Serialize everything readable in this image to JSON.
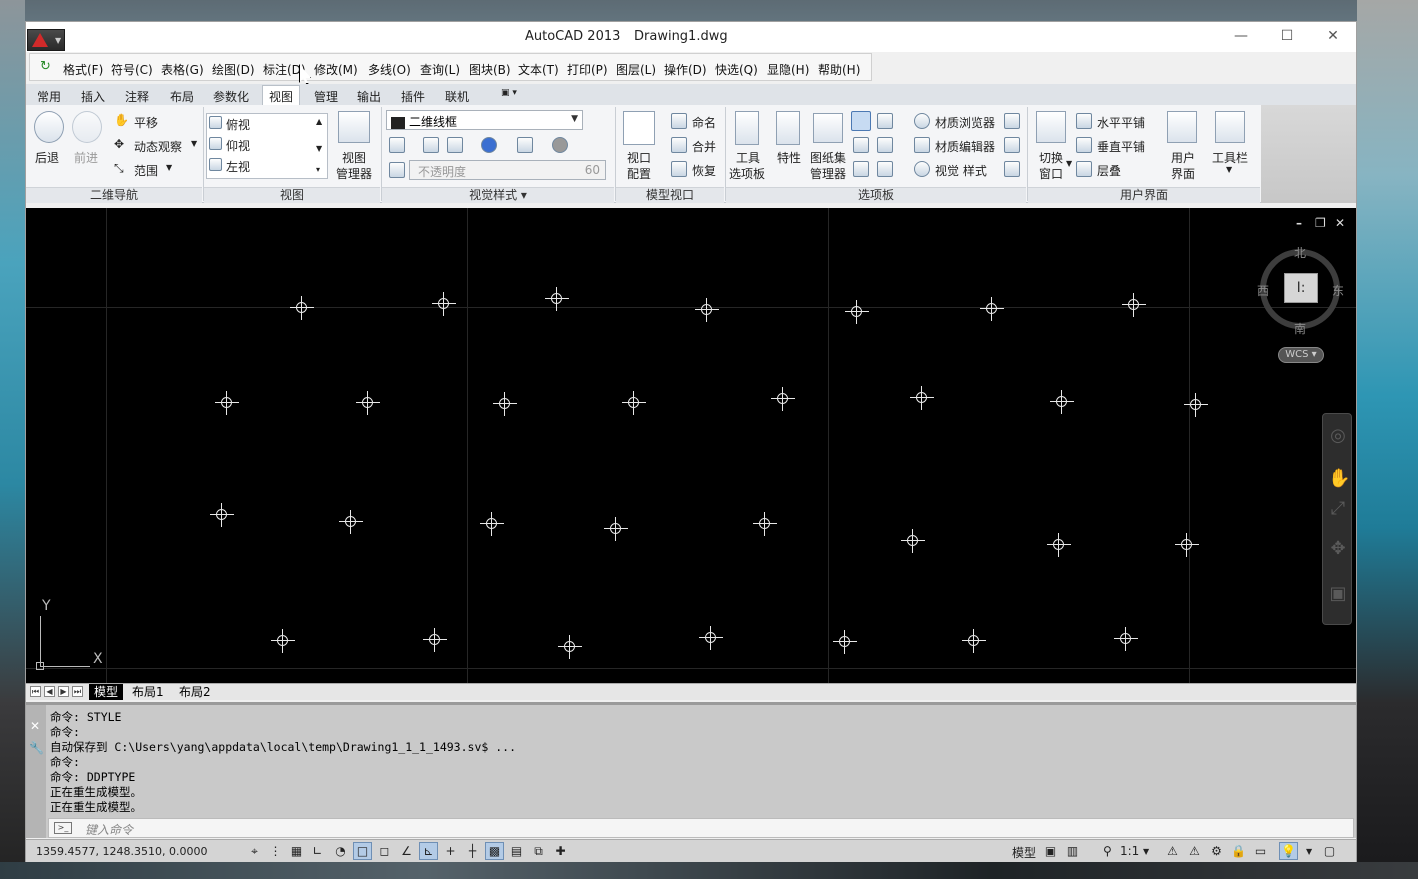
{
  "window": {
    "title": "AutoCAD 2013",
    "file": "Drawing1.dwg",
    "minimize": "—",
    "maximize": "☐",
    "close": "✕"
  },
  "menubar": [
    "格式(F)",
    "符号(C)",
    "表格(G)",
    "绘图(D)",
    "标注(D)",
    "修改(M)",
    "多线(O)",
    "查询(L)",
    "图块(B)",
    "文本(T)",
    "打印(P)",
    "图层(L)",
    "操作(D)",
    "快选(Q)",
    "显隐(H)",
    "帮助(H)"
  ],
  "ribbon_tabs": [
    "常用",
    "插入",
    "注释",
    "布局",
    "参数化",
    "视图",
    "管理",
    "输出",
    "插件",
    "联机"
  ],
  "ribbon": {
    "nav2d": {
      "back": "后退",
      "forward": "前进",
      "pan": "平移",
      "orbit": "动态观察",
      "extents": "范围",
      "label": "二维导航"
    },
    "views": {
      "items": [
        "俯视",
        "仰视",
        "左视"
      ],
      "manager": "视图\n管理器",
      "manager_l1": "视图",
      "manager_l2": "管理器",
      "label": "视图"
    },
    "visual": {
      "style_value": "二维线框",
      "opacity_placeholder": "不透明度",
      "opacity_value": "60",
      "label": "视觉样式"
    },
    "viewports": {
      "config_l1": "视口",
      "config_l2": "配置",
      "name": "命名",
      "merge": "合并",
      "restore": "恢复",
      "label": "模型视口"
    },
    "palettes": {
      "tool_l1": "工具",
      "tool_l2": "选项板",
      "properties": "特性",
      "sheetset_l1": "图纸集",
      "sheetset_l2": "管理器",
      "materials_browser": "材质浏览器",
      "materials_editor": "材质编辑器",
      "visual_styles": "视觉 样式",
      "label": "选项板"
    },
    "ui": {
      "switch_l1": "切换",
      "switch_l2": "窗口",
      "tile_h": "水平平铺",
      "tile_v": "垂直平铺",
      "cascade": "层叠",
      "user_l1": "用户",
      "user_l2": "界面",
      "toolbars": "工具栏",
      "label": "用户界面"
    }
  },
  "canvas": {
    "viewcube": {
      "north": "北",
      "south": "南",
      "west": "西",
      "east": "东",
      "face": "I:",
      "wcs": "WCS"
    },
    "ucs": {
      "x": "X",
      "y": "Y"
    },
    "controls": {
      "minimize": "–",
      "restore": "❐",
      "close": "✕"
    }
  },
  "layout_tabs": [
    "模型",
    "布局1",
    "布局2"
  ],
  "command": {
    "lines": [
      "命令: STYLE",
      "命令:",
      "自动保存到 C:\\Users\\yang\\appdata\\local\\temp\\Drawing1_1_1_1493.sv$ ...",
      "命令:",
      "命令: DDPTYPE",
      "正在重生成模型。",
      "正在重生成模型。"
    ],
    "placeholder": "键入命令"
  },
  "statusbar": {
    "coords": "1359.4577, 1248.3510, 0.0000",
    "model": "模型",
    "scale": "1:1"
  }
}
